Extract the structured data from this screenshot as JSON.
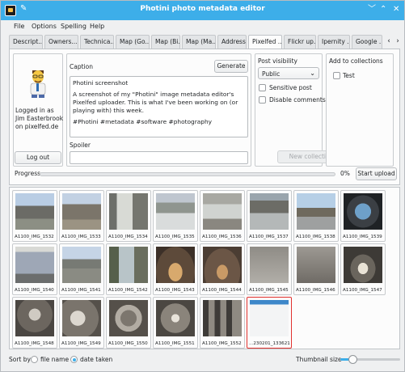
{
  "window": {
    "title": "Photini photo metadata editor",
    "controls": [
      "﹀",
      "⌃",
      "✕"
    ]
  },
  "menu": [
    "File",
    "Options",
    "Spelling",
    "Help"
  ],
  "tabs": [
    {
      "label": "Descript..."
    },
    {
      "label": "Owners..."
    },
    {
      "label": "Technica..."
    },
    {
      "label": "Map (Go..."
    },
    {
      "label": "Map (Bi..."
    },
    {
      "label": "Map (Ma..."
    },
    {
      "label": "Address"
    },
    {
      "label": "Pixelfed ...",
      "active": true
    },
    {
      "label": "Flickr up..."
    },
    {
      "label": "Ipernity ..."
    },
    {
      "label": "Google ..."
    }
  ],
  "account": {
    "status_lines": [
      "Logged in as",
      "Jim Easterbrook",
      "on pixelfed.de"
    ],
    "logout_label": "Log out"
  },
  "caption": {
    "label": "Caption",
    "generate_label": "Generate",
    "title_line": "Photini screenshot",
    "body": "A screenshot of my \"Photini\" image metadata editor's Pixelfed uploader. This is what I've been working on (or playing with) this week.",
    "tags": "#Photini #metadata #software #photography"
  },
  "spoiler": {
    "label": "Spoiler",
    "value": ""
  },
  "visibility": {
    "label": "Post visibility",
    "selected": "Public",
    "sensitive_label": "Sensitive post",
    "disable_comments_label": "Disable comments",
    "new_collection_label": "New collection"
  },
  "collections": {
    "label": "Add to collections",
    "items": [
      "Test"
    ]
  },
  "progress": {
    "label": "Progress",
    "value": 0,
    "value_text": "0%",
    "start_label": "Start upload"
  },
  "thumbnails": [
    {
      "name": "A1100_IMG_1532"
    },
    {
      "name": "A1100_IMG_1533"
    },
    {
      "name": "A1100_IMG_1534"
    },
    {
      "name": "A1100_IMG_1535"
    },
    {
      "name": "A1100_IMG_1536"
    },
    {
      "name": "A1100_IMG_1537"
    },
    {
      "name": "A1100_IMG_1538"
    },
    {
      "name": "A1100_IMG_1539"
    },
    {
      "name": "A1100_IMG_1540"
    },
    {
      "name": "A1100_IMG_1541"
    },
    {
      "name": "A1100_IMG_1542"
    },
    {
      "name": "A1100_IMG_1543"
    },
    {
      "name": "A1100_IMG_1544"
    },
    {
      "name": "A1100_IMG_1545"
    },
    {
      "name": "A1100_IMG_1546"
    },
    {
      "name": "A1100_IMG_1547"
    },
    {
      "name": "A1100_IMG_1548"
    },
    {
      "name": "A1100_IMG_1549"
    },
    {
      "name": "A1100_IMG_1550"
    },
    {
      "name": "A1100_IMG_1551"
    },
    {
      "name": "A1100_IMG_1552"
    },
    {
      "name": "...230201_133621",
      "selected": true
    }
  ],
  "sort": {
    "label": "Sort by",
    "options": [
      "file name",
      "date taken"
    ],
    "selected": "date taken"
  },
  "thumbnail_size": {
    "label": "Thumbnail size",
    "value": 0.2
  },
  "colors": {
    "accent": "#3daee9",
    "selection": "#e1312e",
    "background": "#eff0f1"
  }
}
